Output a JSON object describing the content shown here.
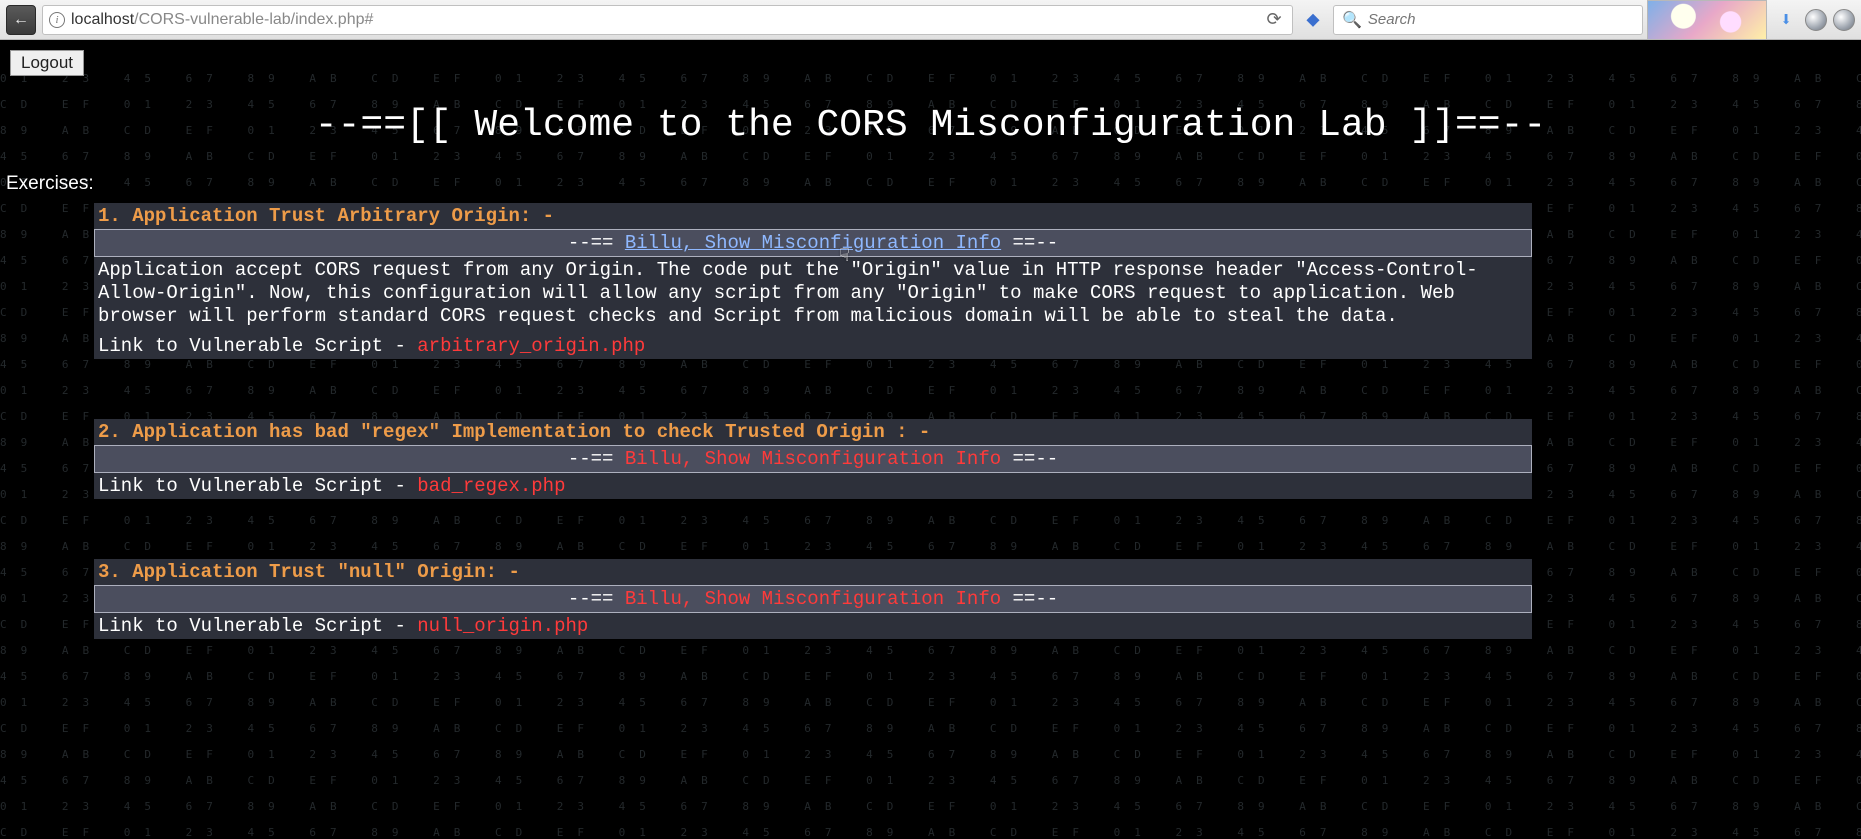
{
  "browser": {
    "url_host": "localhost",
    "url_path": "/CORS-vulnerable-lab/index.php#",
    "search_placeholder": "Search",
    "back_glyph": "←",
    "info_glyph": "i",
    "reload_glyph": "⟳",
    "bookmark_glyph": "◆",
    "download_glyph": "⬇",
    "magnifier_glyph": "🔍"
  },
  "page": {
    "logout_label": "Logout",
    "title": "--==[[ Welcome to the CORS Misconfiguration Lab ]]==--",
    "exercises_label": "Exercises:",
    "toggle_prefix": "--== ",
    "toggle_link_text": "Billu, Show Misconfiguration Info",
    "toggle_suffix": " ==--",
    "link_prefix": "Link to Vulnerable Script - ",
    "exercises": [
      {
        "heading": "1. Application Trust Arbitrary Origin: -",
        "expanded": true,
        "description": "Application accept CORS request from any Origin. The code put the \"Origin\" value in HTTP response header \"Access-Control-Allow-Origin\". Now, this configuration will allow any script from any \"Origin\" to make CORS request to application. Web browser will perform standard CORS request checks and Script from malicious domain will be able to steal the data.",
        "script": "arbitrary_origin.php"
      },
      {
        "heading": "2. Application has bad \"regex\" Implementation to check Trusted Origin : -",
        "expanded": false,
        "description": "",
        "script": "bad_regex.php"
      },
      {
        "heading": "3. Application Trust \"null\" Origin: -",
        "expanded": false,
        "description": "",
        "script": "null_origin.php"
      }
    ]
  }
}
